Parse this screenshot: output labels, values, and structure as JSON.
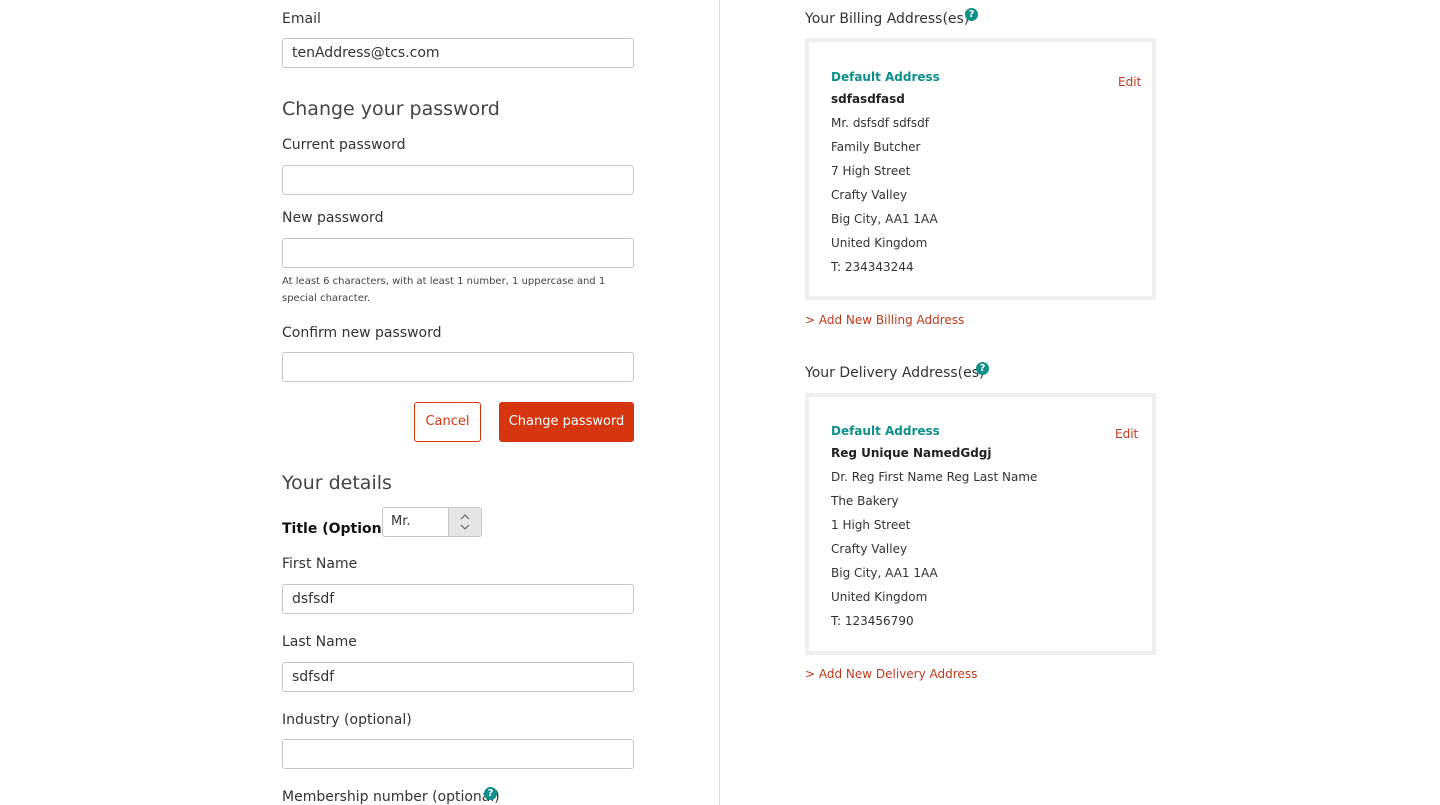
{
  "left": {
    "email_label": "Email",
    "email_value": "tenAddress@tcs.com",
    "change_password_heading": "Change your password",
    "current_password_label": "Current password",
    "new_password_label": "New password",
    "password_hint": "At least 6 characters, with at least 1 number, 1 uppercase and 1 special character.",
    "confirm_password_label": "Confirm new password",
    "cancel_label": "Cancel",
    "change_password_label": "Change password",
    "details_heading": "Your details",
    "title_label": "Title (Optional)",
    "title_value": "Mr.",
    "first_name_label": "First Name",
    "first_name_value": "dsfsdf",
    "last_name_label": "Last Name",
    "last_name_value": "sdfsdf",
    "industry_label": "Industry (optional)",
    "membership_label": "Membership number (optional)"
  },
  "billing": {
    "heading": "Your Billing Address(es)",
    "default_label": "Default Address",
    "edit_label": "Edit",
    "name": "sdfasdfasd",
    "lines": [
      "Mr. dsfsdf sdfsdf",
      "Family Butcher",
      "7 High Street",
      "Crafty Valley",
      "Big City, AA1 1AA",
      "United Kingdom",
      "T: 234343244"
    ],
    "add_link": "> Add New Billing Address"
  },
  "delivery": {
    "heading": "Your Delivery Address(es)",
    "default_label": "Default Address",
    "edit_label": "Edit",
    "name": "Reg Unique NamedGdgj",
    "lines": [
      "Dr. Reg First Name Reg Last Name",
      "The Bakery",
      "1 High Street",
      "Crafty Valley",
      "Big City, AA1 1AA",
      "United Kingdom",
      "T: 123456790"
    ],
    "add_link": "> Add New Delivery Address"
  },
  "help_icon_glyph": "?",
  "colors": {
    "accent": "#d6360f",
    "teal": "#0e8f8a",
    "link": "#c0391b"
  }
}
